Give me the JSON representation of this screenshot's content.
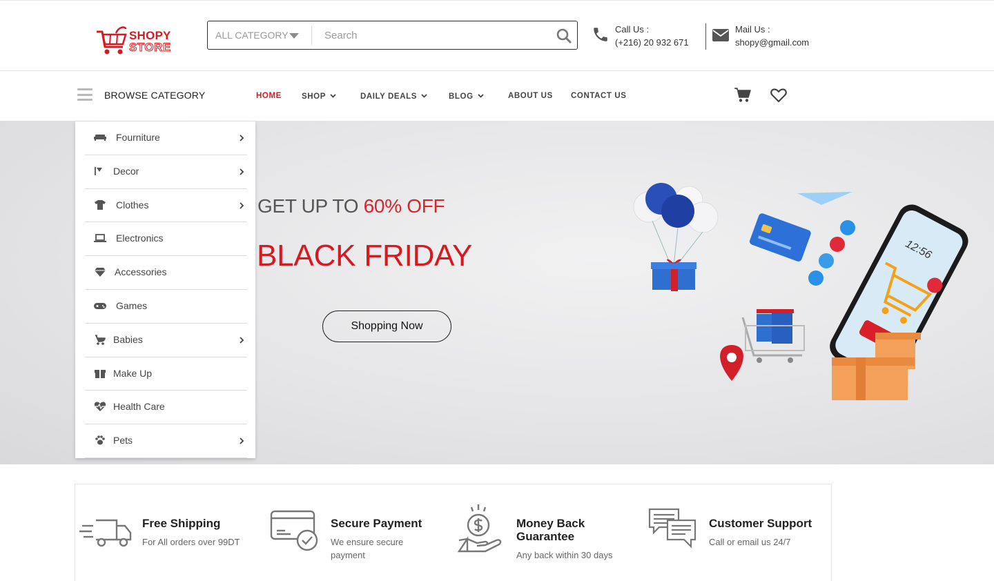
{
  "brand": {
    "line1": "SHOPY",
    "line2": "STORE"
  },
  "search": {
    "category": "ALL CATEGORY",
    "placeholder": "Search"
  },
  "contact": {
    "call_label": "Call Us :",
    "call_value": "(+216) 20 932 671",
    "mail_label": "Mail Us :",
    "mail_value": "shopy@gmail.com"
  },
  "nav": {
    "browse_label": "BROWSE CATEGORY",
    "items": [
      {
        "label": "HOME",
        "active": true
      },
      {
        "label": "SHOP",
        "has_dropdown": true
      },
      {
        "label": "DAILY DEALS",
        "has_dropdown": true
      },
      {
        "label": "BLOG",
        "has_dropdown": true
      },
      {
        "label": "ABOUT US"
      },
      {
        "label": "CONTACT US"
      }
    ]
  },
  "categories": [
    {
      "label": "Fourniture",
      "icon": "sofa-icon",
      "has_submenu": true
    },
    {
      "label": "Decor",
      "icon": "paint-roller-icon",
      "has_submenu": true
    },
    {
      "label": "Clothes",
      "icon": "tshirt-icon",
      "has_submenu": true
    },
    {
      "label": "Electronics",
      "icon": "laptop-icon",
      "has_submenu": false
    },
    {
      "label": "Accessories",
      "icon": "gem-icon",
      "has_submenu": false
    },
    {
      "label": "Games",
      "icon": "gamepad-icon",
      "has_submenu": false
    },
    {
      "label": "Babies",
      "icon": "baby-carriage-icon",
      "has_submenu": true
    },
    {
      "label": "Make Up",
      "icon": "gift-icon",
      "has_submenu": false
    },
    {
      "label": "Health Care",
      "icon": "heartbeat-icon",
      "has_submenu": false
    },
    {
      "label": "Pets",
      "icon": "paw-icon",
      "has_submenu": true
    }
  ],
  "hero": {
    "promo_prefix": "GET UP TO ",
    "promo_highlight": "60% OFF",
    "headline": "BLACK FRIDAY",
    "cta": "Shopping Now"
  },
  "features": [
    {
      "title": "Free Shipping",
      "subtitle": "For All orders over 99DT",
      "icon": "delivery-truck-icon"
    },
    {
      "title": "Secure Payment",
      "subtitle": "We ensure secure payment",
      "icon": "credit-card-icon"
    },
    {
      "title": "Money Back Guarantee",
      "subtitle": "Any back within 30 days",
      "icon": "money-hand-icon"
    },
    {
      "title": "Customer Support",
      "subtitle": "Call or email us 24/7",
      "icon": "chat-bubbles-icon"
    }
  ],
  "colors": {
    "accent": "#d71920",
    "text": "#333333",
    "hero_bg": "#e5e5e7"
  }
}
